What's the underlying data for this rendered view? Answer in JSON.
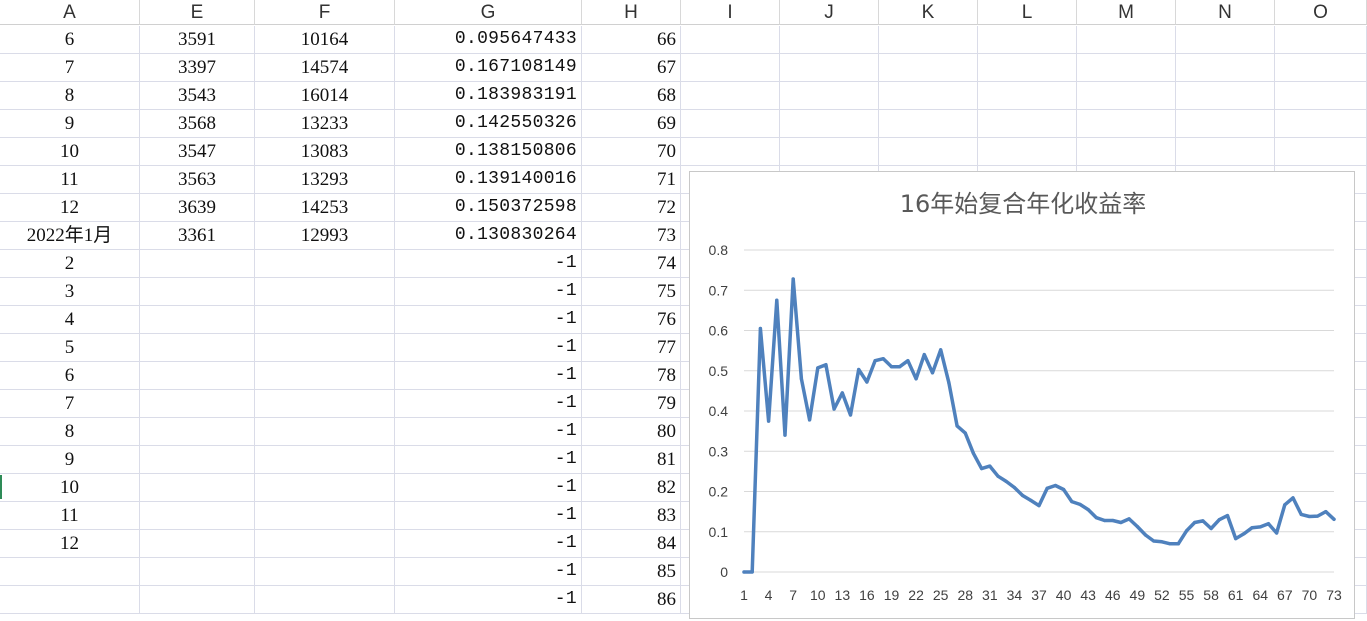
{
  "columns": [
    "A",
    "E",
    "F",
    "G",
    "H",
    "I",
    "J",
    "K",
    "L",
    "M",
    "N",
    "O"
  ],
  "rows": [
    {
      "a": "6",
      "e": "3591",
      "f": "10164",
      "g": "0.095647433",
      "h": "66"
    },
    {
      "a": "7",
      "e": "3397",
      "f": "14574",
      "g": "0.167108149",
      "h": "67"
    },
    {
      "a": "8",
      "e": "3543",
      "f": "16014",
      "g": "0.183983191",
      "h": "68"
    },
    {
      "a": "9",
      "e": "3568",
      "f": "13233",
      "g": "0.142550326",
      "h": "69"
    },
    {
      "a": "10",
      "e": "3547",
      "f": "13083",
      "g": "0.138150806",
      "h": "70"
    },
    {
      "a": "11",
      "e": "3563",
      "f": "13293",
      "g": "0.139140016",
      "h": "71"
    },
    {
      "a": "12",
      "e": "3639",
      "f": "14253",
      "g": "0.150372598",
      "h": "72"
    },
    {
      "a": "2022年1月",
      "e": "3361",
      "f": "12993",
      "g": "0.130830264",
      "h": "73"
    },
    {
      "a": "2",
      "e": "",
      "f": "",
      "g": "-1",
      "h": "74"
    },
    {
      "a": "3",
      "e": "",
      "f": "",
      "g": "-1",
      "h": "75"
    },
    {
      "a": "4",
      "e": "",
      "f": "",
      "g": "-1",
      "h": "76"
    },
    {
      "a": "5",
      "e": "",
      "f": "",
      "g": "-1",
      "h": "77"
    },
    {
      "a": "6",
      "e": "",
      "f": "",
      "g": "-1",
      "h": "78"
    },
    {
      "a": "7",
      "e": "",
      "f": "",
      "g": "-1",
      "h": "79"
    },
    {
      "a": "8",
      "e": "",
      "f": "",
      "g": "-1",
      "h": "80"
    },
    {
      "a": "9",
      "e": "",
      "f": "",
      "g": "-1",
      "h": "81"
    },
    {
      "a": "10",
      "e": "",
      "f": "",
      "g": "-1",
      "h": "82"
    },
    {
      "a": "11",
      "e": "",
      "f": "",
      "g": "-1",
      "h": "83"
    },
    {
      "a": "12",
      "e": "",
      "f": "",
      "g": "-1",
      "h": "84"
    },
    {
      "a": "",
      "e": "",
      "f": "",
      "g": "-1",
      "h": "85"
    },
    {
      "a": "",
      "e": "",
      "f": "",
      "g": "-1",
      "h": "86"
    }
  ],
  "chart_data": {
    "type": "line",
    "title": "16年始复合年化收益率",
    "xlabel": "",
    "ylabel": "",
    "ylim": [
      0,
      0.8
    ],
    "yticks": [
      "0",
      "0.1",
      "0.2",
      "0.3",
      "0.4",
      "0.5",
      "0.6",
      "0.7",
      "0.8"
    ],
    "xticks": [
      "1",
      "4",
      "7",
      "10",
      "13",
      "16",
      "19",
      "22",
      "25",
      "28",
      "31",
      "34",
      "37",
      "40",
      "43",
      "46",
      "49",
      "52",
      "55",
      "58",
      "61",
      "64",
      "67",
      "70",
      "73"
    ],
    "grid": true,
    "legend": "none",
    "color": "#4f81bd",
    "x": [
      1,
      2,
      3,
      4,
      5,
      6,
      7,
      8,
      9,
      10,
      11,
      12,
      13,
      14,
      15,
      16,
      17,
      18,
      19,
      20,
      21,
      22,
      23,
      24,
      25,
      26,
      27,
      28,
      29,
      30,
      31,
      32,
      33,
      34,
      35,
      36,
      37,
      38,
      39,
      40,
      41,
      42,
      43,
      44,
      45,
      46,
      47,
      48,
      49,
      50,
      51,
      52,
      53,
      54,
      55,
      56,
      57,
      58,
      59,
      60,
      61,
      62,
      63,
      64,
      65,
      66,
      67,
      68,
      69,
      70,
      71,
      72,
      73
    ],
    "series": [
      {
        "values": [
          0,
          0,
          0.605,
          0.375,
          0.675,
          0.34,
          0.728,
          0.48,
          0.378,
          0.507,
          0.515,
          0.405,
          0.445,
          0.39,
          0.503,
          0.472,
          0.525,
          0.53,
          0.51,
          0.51,
          0.525,
          0.48,
          0.54,
          0.495,
          0.552,
          0.47,
          0.363,
          0.345,
          0.295,
          0.257,
          0.263,
          0.238,
          0.225,
          0.21,
          0.19,
          0.178,
          0.165,
          0.208,
          0.215,
          0.205,
          0.175,
          0.168,
          0.155,
          0.135,
          0.128,
          0.128,
          0.123,
          0.132,
          0.113,
          0.092,
          0.077,
          0.075,
          0.07,
          0.07,
          0.102,
          0.123,
          0.127,
          0.108,
          0.13,
          0.14,
          0.083,
          0.095,
          0.11,
          0.112,
          0.12,
          0.097,
          0.167,
          0.184,
          0.143,
          0.138,
          0.139,
          0.15,
          0.131
        ]
      }
    ]
  }
}
